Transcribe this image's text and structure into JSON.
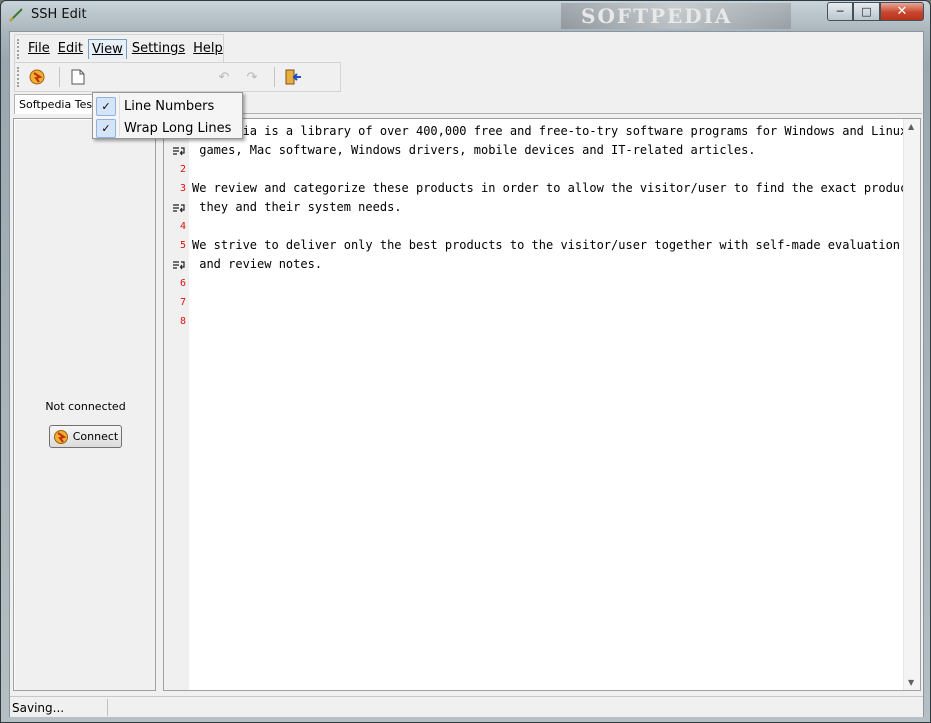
{
  "window": {
    "title": "SSH Edit",
    "watermark": "SOFTPEDIA"
  },
  "menu": {
    "file": "File",
    "edit": "Edit",
    "view": "View",
    "settings": "Settings",
    "help": "Help"
  },
  "view_menu": {
    "line_numbers": {
      "label": "Line Numbers",
      "checked": true
    },
    "wrap_long_lines": {
      "label": "Wrap Long Lines",
      "checked": true
    }
  },
  "tab": {
    "label": "Softpedia Test"
  },
  "connection": {
    "status": "Not connected",
    "connect_label": "Connect"
  },
  "editor": {
    "lines": [
      {
        "num": "1",
        "text": "Softpedia is a library of over 400,000 free and free-to-try software programs for Windows and Linux,"
      },
      {
        "num": "",
        "text": " games, Mac software, Windows drivers, mobile devices and IT-related articles.",
        "wrapped": true
      },
      {
        "num": "2",
        "text": ""
      },
      {
        "num": "3",
        "text": "We review and categorize these products in order to allow the visitor/user to find the exact product"
      },
      {
        "num": "",
        "text": " they and their system needs.",
        "wrapped": true
      },
      {
        "num": "4",
        "text": ""
      },
      {
        "num": "5",
        "text": "We strive to deliver only the best products to the visitor/user together with self-made evaluation"
      },
      {
        "num": "",
        "text": " and review notes.",
        "wrapped": true
      },
      {
        "num": "6",
        "text": ""
      },
      {
        "num": "7",
        "text": ""
      },
      {
        "num": "8",
        "text": ""
      }
    ]
  },
  "statusbar": {
    "text": "Saving..."
  }
}
